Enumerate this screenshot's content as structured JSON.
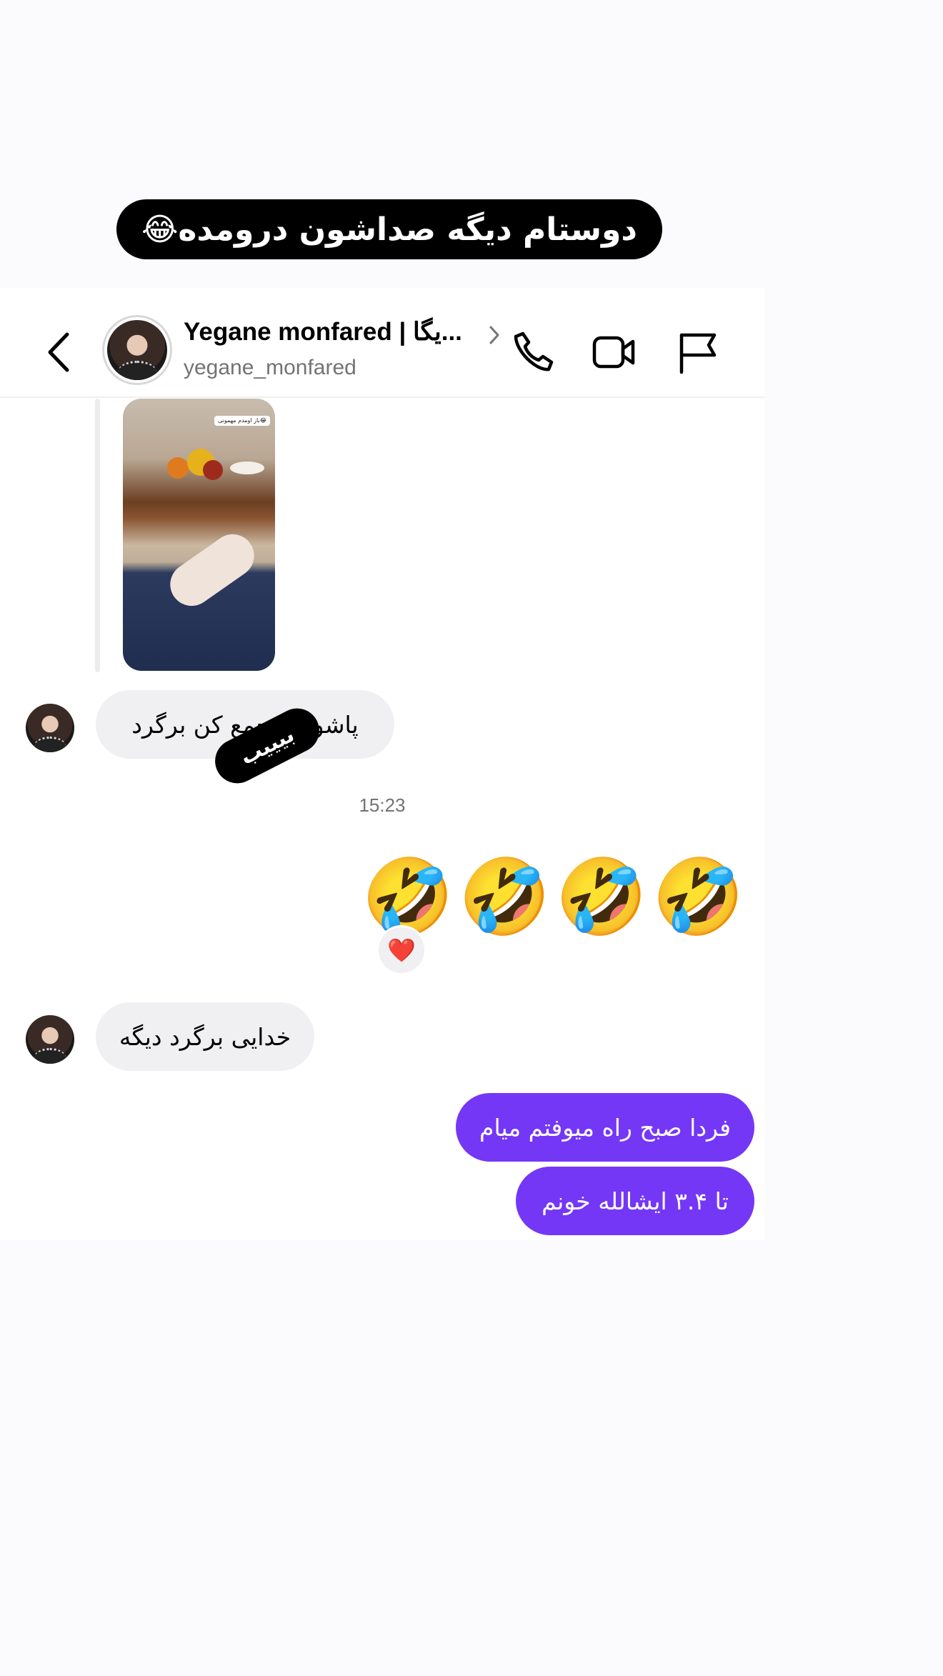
{
  "caption": "دوستام دیگه صداشون درومده😂",
  "header": {
    "name": "Yegane monfared | یگا...",
    "username": "yegane_monfared"
  },
  "post": {
    "sticker": "باز اومدم مهمونی😂"
  },
  "messages": {
    "incoming_1": "پاشو کم جمع کن برگرد",
    "censor_sticker": "بیییب",
    "timestamp": "15:23",
    "emoji": "🤣🤣🤣🤣",
    "reaction": "❤️",
    "incoming_2": "خدایی برگرد دیگه",
    "outgoing_1": "فردا صبح راه میوفتم میام",
    "outgoing_2": "تا ۳.۴ ایشالله خونم"
  },
  "colors": {
    "outgoing_bubble": "#7437f6",
    "incoming_bubble": "#f0f0f2",
    "caption_bg": "#000000"
  },
  "icons": [
    "back-icon",
    "chevron-right-icon",
    "phone-icon",
    "video-icon",
    "flag-icon"
  ]
}
